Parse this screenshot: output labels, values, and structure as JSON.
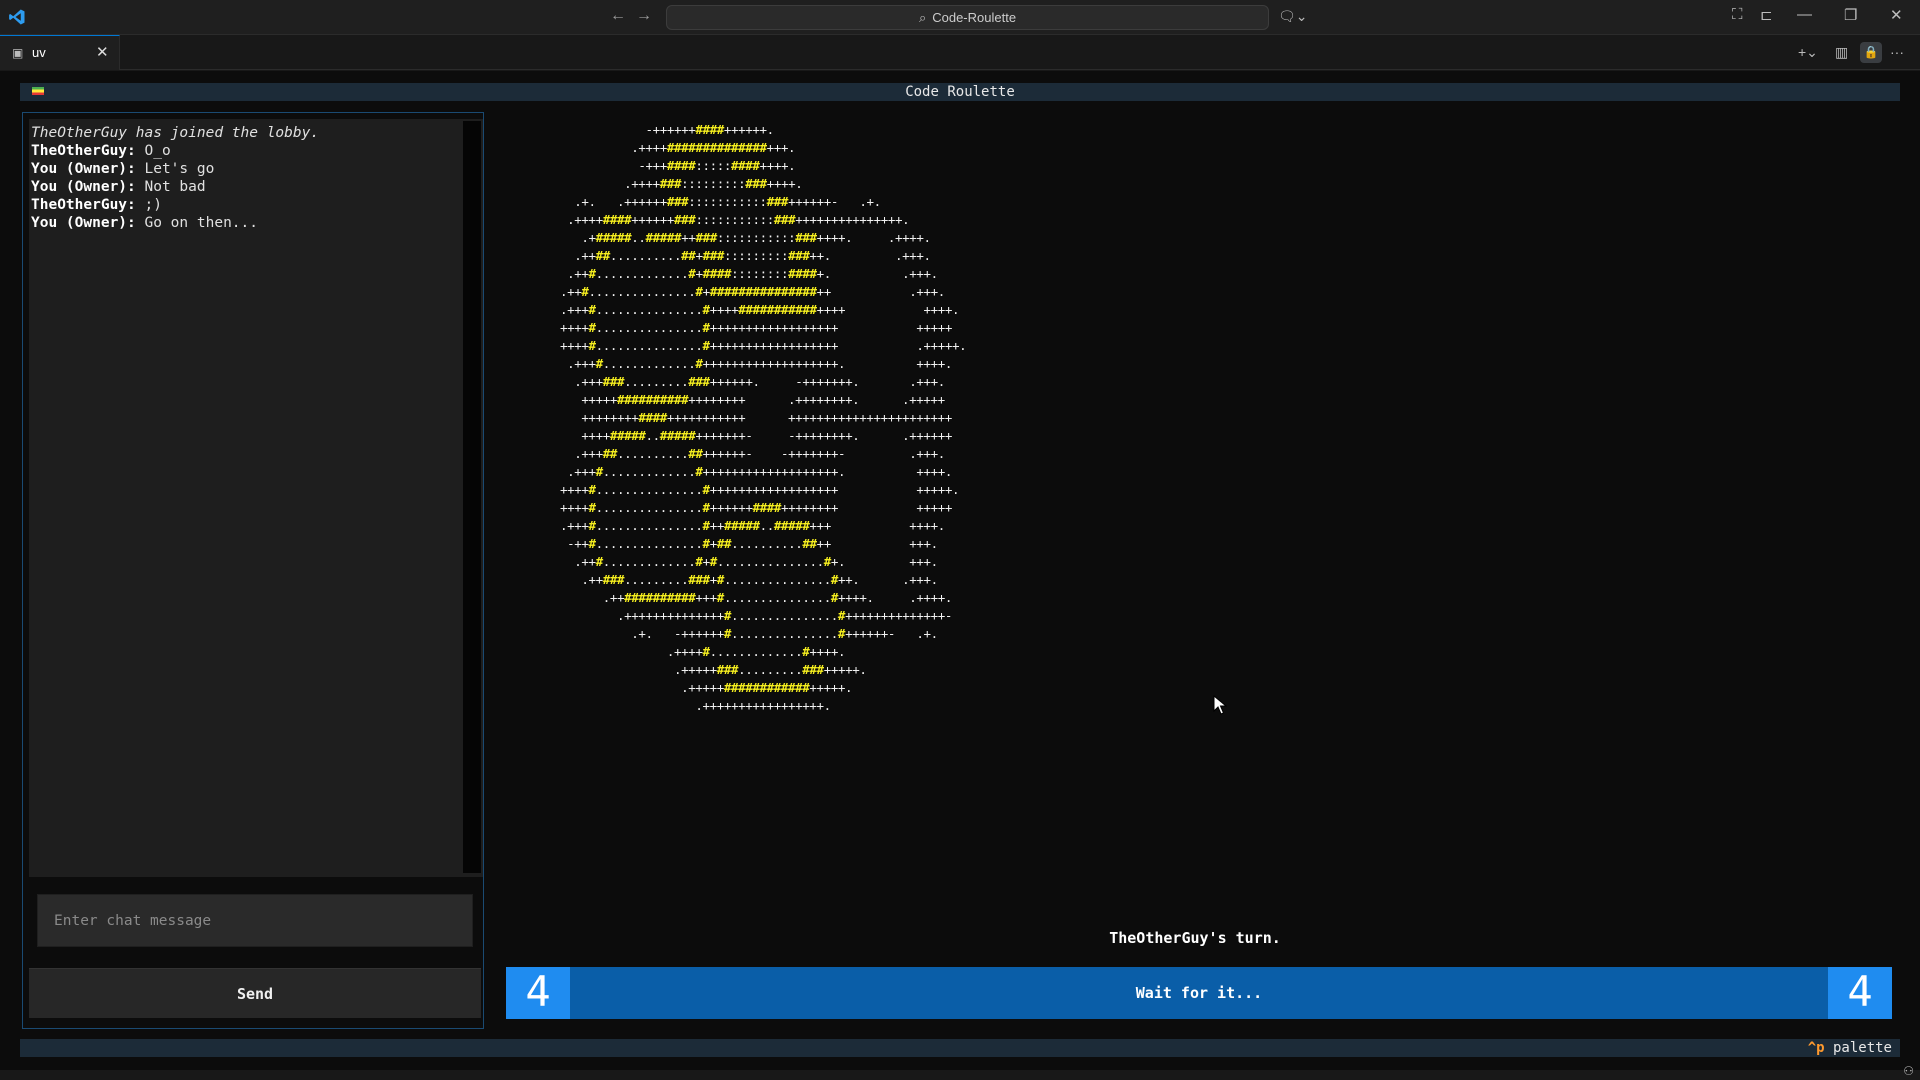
{
  "titlebar": {
    "search_text": "Code-Roulette",
    "back_icon": "arrow-left-icon",
    "forward_icon": "arrow-right-icon"
  },
  "tabs": [
    {
      "label": "uv",
      "icon": "preview-icon",
      "active": true
    }
  ],
  "app": {
    "title": "Code Roulette",
    "palette_key": "^p",
    "palette_label": "palette"
  },
  "chat": {
    "messages": [
      {
        "author": "",
        "text": "TheOtherGuy has joined the lobby.",
        "system": true
      },
      {
        "author": "TheOtherGuy:",
        "text": " O_o"
      },
      {
        "author": "You (Owner):",
        "text": " Let's go"
      },
      {
        "author": "You (Owner):",
        "text": " Not bad"
      },
      {
        "author": "TheOtherGuy:",
        "text": " ;)"
      },
      {
        "author": "You (Owner):",
        "text": " Go on then..."
      }
    ],
    "input_placeholder": "Enter chat message",
    "send_label": "Send"
  },
  "game": {
    "art_lines": [
      "            -++++++####++++++.",
      "          .++++##############+++.",
      "           -+++####:::::####++++.",
      "         .++++###:::::::::###++++.",
      "  .+.   .++++++###:::::::::::###++++++-   .+.",
      " .++++####++++++###:::::::::::###+++++++++++++++.",
      "   .+#####..#####++###:::::::::::###++++.     .++++.",
      "  .++##..........##+###:::::::::###++.         .+++.",
      " .++#.............#+####::::::::####+.          .+++.",
      ".++#...............#+###############++           .+++.",
      ".+++#...............#++++###########++++           ++++.",
      "++++#...............#++++++++++++++++++           +++++",
      "++++#...............#++++++++++++++++++           .+++++.",
      " .+++#.............#+++++++++++++++++++.          ++++.",
      "  .+++###.........###++++++.     -+++++++.       .+++.",
      "   +++++##########++++++++      .++++++++.      .+++++",
      "   ++++++++####+++++++++++      +++++++++++++++++++++++",
      "   ++++#####..#####+++++++-     -++++++++.      .++++++",
      "  .+++##..........##++++++-    -+++++++-         .+++.",
      " .+++#.............#+++++++++++++++++++.          ++++.",
      "++++#...............#++++++++++++++++++           +++++.",
      "++++#...............#++++++####++++++++           +++++",
      ".+++#...............#++#####..#####+++           ++++.",
      " -++#...............#+##..........##++           +++.",
      "  .++#.............#+#...............#+.         +++.",
      "   .++###.........###+#...............#++.      .+++.",
      "      .++##########+++#...............#++++.     .++++.",
      "        .++++++++++++++#...............#++++++++++++++-",
      "          .+.   -++++++#...............#++++++-   .+.",
      "               .++++#.............#++++.",
      "                .+++++###.........###+++++.",
      "                 .+++++############+++++.",
      "                   .+++++++++++++++++."
    ],
    "turn_status": "TheOtherGuy's turn.",
    "wait_label": "Wait for it...",
    "countdown": "4"
  }
}
